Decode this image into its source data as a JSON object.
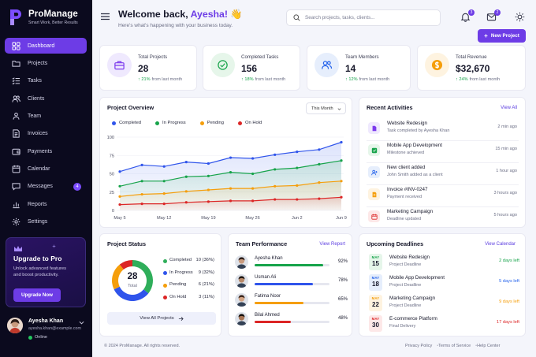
{
  "brand": {
    "name": "ProManage",
    "tagline": "Smart Work, Better Results"
  },
  "nav": [
    {
      "label": "Dashboard",
      "icon": "grid-icon",
      "active": true
    },
    {
      "label": "Projects",
      "icon": "folder-icon"
    },
    {
      "label": "Tasks",
      "icon": "checklist-icon"
    },
    {
      "label": "Clients",
      "icon": "users-icon"
    },
    {
      "label": "Team",
      "icon": "team-icon"
    },
    {
      "label": "Invoices",
      "icon": "invoice-icon"
    },
    {
      "label": "Payments",
      "icon": "wallet-icon"
    },
    {
      "label": "Calendar",
      "icon": "calendar-icon"
    },
    {
      "label": "Messages",
      "icon": "chat-icon",
      "badge": "4"
    },
    {
      "label": "Reports",
      "icon": "report-icon"
    },
    {
      "label": "Settings",
      "icon": "gear-icon"
    }
  ],
  "upgrade": {
    "title": "Upgrade to Pro",
    "text_line1": "Unlock advanced features",
    "text_line2": "and boost productivity.",
    "button": "Upgrade Now"
  },
  "user": {
    "name": "Ayesha Khan",
    "email": "ayesha.khan@example.com",
    "status": "Online"
  },
  "header": {
    "greeting": "Welcome back, ",
    "name": "Ayesha!",
    "emoji": "👋",
    "subtitle": "Here's what's happening with your business today.",
    "search_placeholder": "Search projects, tasks, clients...",
    "notifications_count": "3",
    "messages_count": "2",
    "new_project": "New Project"
  },
  "stats": [
    {
      "label": "Total Projects",
      "value": "28",
      "trend": "21%",
      "note": "from last month",
      "icon": "briefcase-icon",
      "color": "#7c3aed",
      "bg": "#efe9fe"
    },
    {
      "label": "Completed Tasks",
      "value": "156",
      "trend": "18%",
      "note": "from last month",
      "icon": "check-circle-icon",
      "color": "#16a34a",
      "bg": "#e6f6ea"
    },
    {
      "label": "Team Members",
      "value": "14",
      "trend": "12%",
      "note": "from last month",
      "icon": "users-icon",
      "color": "#2563eb",
      "bg": "#e6eefc"
    },
    {
      "label": "Total Revenue",
      "value": "$32,670",
      "trend": "24%",
      "note": "from last month",
      "icon": "dollar-icon",
      "color": "#f59e0b",
      "bg": "#fef3e0"
    }
  ],
  "overview": {
    "title": "Project Overview",
    "period": "This Month"
  },
  "chart_data": {
    "type": "area",
    "title": "Project Overview",
    "x": [
      "May 5",
      "May 8",
      "May 12",
      "May 15",
      "May 19",
      "May 22",
      "May 26",
      "May 29",
      "Jun 2",
      "Jun 5",
      "Jun 9"
    ],
    "xticks": [
      "May 5",
      "May 12",
      "May 19",
      "May 26",
      "Jun 2",
      "Jun 9"
    ],
    "ylim": [
      0,
      100
    ],
    "yticks": [
      0,
      25,
      50,
      75,
      100
    ],
    "grid": true,
    "legend": "top-left",
    "series": [
      {
        "name": "Completed",
        "color": "#2f54eb",
        "values": [
          53,
          62,
          60,
          66,
          64,
          72,
          71,
          76,
          80,
          83,
          93
        ]
      },
      {
        "name": "In Progress",
        "color": "#16a34a",
        "values": [
          33,
          40,
          40,
          46,
          47,
          52,
          50,
          56,
          58,
          63,
          68
        ]
      },
      {
        "name": "Pending",
        "color": "#f59e0b",
        "values": [
          19,
          22,
          23,
          26,
          28,
          30,
          30,
          33,
          34,
          38,
          40
        ]
      },
      {
        "name": "On Hold",
        "color": "#dc2626",
        "values": [
          8,
          9,
          9,
          11,
          12,
          13,
          13,
          15,
          15,
          16,
          18
        ]
      }
    ]
  },
  "activities": {
    "title": "Recent Activities",
    "link": "View All",
    "items": [
      {
        "title": "Website Redesign",
        "sub": "Task completed by Ayesha Khan",
        "time": "2 min ago",
        "icon": "doc-icon",
        "color": "#7c3aed",
        "bg": "#efe9fe"
      },
      {
        "title": "Mobile App Development",
        "sub": "Milestone achieved",
        "time": "15 min ago",
        "icon": "check-icon",
        "color": "#16a34a",
        "bg": "#e6f6ea"
      },
      {
        "title": "New client added",
        "sub": "John Smith added as a client",
        "time": "1 hour ago",
        "icon": "user-plus-icon",
        "color": "#2563eb",
        "bg": "#e6eefc"
      },
      {
        "title": "Invoice #INV-0247",
        "sub": "Payment received",
        "time": "3 hours ago",
        "icon": "invoice-icon",
        "color": "#f59e0b",
        "bg": "#fef3e0"
      },
      {
        "title": "Marketing Campaign",
        "sub": "Deadline updated",
        "time": "5 hours ago",
        "icon": "calendar-icon",
        "color": "#dc2626",
        "bg": "#fde8e8"
      }
    ]
  },
  "project_status": {
    "title": "Project Status",
    "total": "28",
    "total_label": "Total",
    "button": "View All Projects",
    "items": [
      {
        "label": "Completed",
        "value": "10 (36%)",
        "count": 10,
        "color": "#2fae5a"
      },
      {
        "label": "In Progress",
        "value": "9 (32%)",
        "count": 9,
        "color": "#2f54eb"
      },
      {
        "label": "Pending",
        "value": "6 (21%)",
        "count": 6,
        "color": "#f59e0b"
      },
      {
        "label": "On Hold",
        "value": "3 (11%)",
        "count": 3,
        "color": "#dc2626"
      }
    ]
  },
  "team": {
    "title": "Team Performance",
    "link": "View Report",
    "members": [
      {
        "name": "Ayesha Khan",
        "pct": "92%",
        "value": 92,
        "color": "#16a34a",
        "skin": "#c99b7e",
        "hair": "#2b1d18"
      },
      {
        "name": "Usman Ali",
        "pct": "78%",
        "value": 78,
        "color": "#2f54eb",
        "skin": "#b98a6a",
        "hair": "#1c1410"
      },
      {
        "name": "Fatima Noor",
        "pct": "65%",
        "value": 65,
        "color": "#f59e0b",
        "skin": "#d3a585",
        "hair": "#3a251b"
      },
      {
        "name": "Bilal Ahmed",
        "pct": "48%",
        "value": 48,
        "color": "#dc2626",
        "skin": "#a87656",
        "hair": "#15100d"
      }
    ]
  },
  "deadlines": {
    "title": "Upcoming Deadlines",
    "link": "View Calendar",
    "items": [
      {
        "month": "MAY",
        "day": "15",
        "title": "Website Redesign",
        "sub": "Project Deadline",
        "due": "2 days left",
        "color": "#16a34a",
        "bg": "#e6f6ea"
      },
      {
        "month": "MAY",
        "day": "18",
        "title": "Mobile App Development",
        "sub": "Project Deadline",
        "due": "5 days left",
        "color": "#2563eb",
        "bg": "#e6eefc"
      },
      {
        "month": "MAY",
        "day": "22",
        "title": "Marketing Campaign",
        "sub": "Project Deadline",
        "due": "9 days left",
        "color": "#f59e0b",
        "bg": "#fef3e0"
      },
      {
        "month": "MAY",
        "day": "30",
        "title": "E-commerce Platform",
        "sub": "Final Delivery",
        "due": "17 days left",
        "color": "#dc2626",
        "bg": "#fde8e8"
      }
    ]
  },
  "footer": {
    "copyright": "© 2024 ProManage. All rights reserved.",
    "links": [
      "Privacy Policy",
      "Terms of Service",
      "Help Center"
    ]
  }
}
